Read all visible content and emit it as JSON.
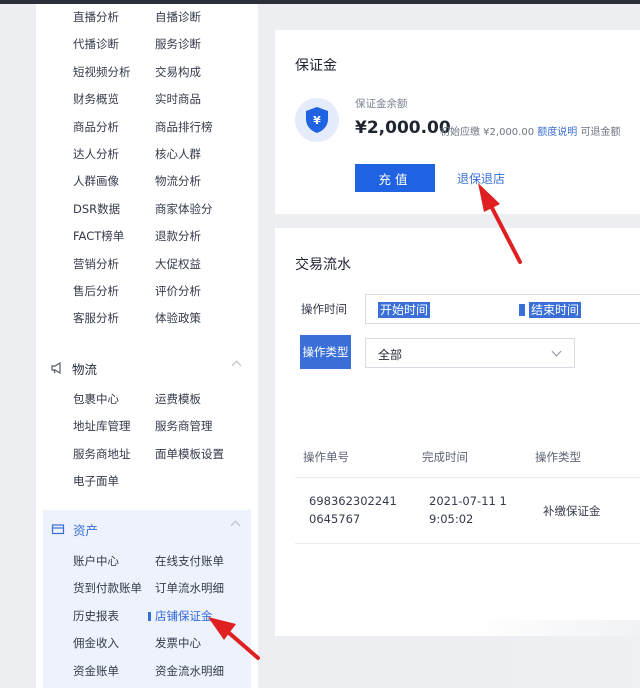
{
  "sidebar": {
    "top_items": [
      [
        "直播分析",
        "自播诊断"
      ],
      [
        "代播诊断",
        "服务诊断"
      ],
      [
        "短视频分析",
        "交易构成"
      ],
      [
        "财务概览",
        "实时商品"
      ],
      [
        "商品分析",
        "商品排行榜"
      ],
      [
        "达人分析",
        "核心人群"
      ],
      [
        "人群画像",
        "物流分析"
      ],
      [
        "DSR数据",
        "商家体验分"
      ],
      [
        "FACT榜单",
        "退款分析"
      ],
      [
        "营销分析",
        "大促权益"
      ],
      [
        "售后分析",
        "评价分析"
      ],
      [
        "客服分析",
        "体验政策"
      ]
    ],
    "logistics": {
      "title": "物流",
      "items": [
        [
          "包裹中心",
          "运费模板"
        ],
        [
          "地址库管理",
          "服务商管理"
        ],
        [
          "服务商地址",
          "面单模板设置"
        ],
        [
          "电子面单",
          ""
        ]
      ]
    },
    "assets": {
      "title": "资产",
      "items": [
        [
          "账户中心",
          "在线支付账单"
        ],
        [
          "货到付款账单",
          "订单流水明细"
        ],
        [
          "历史报表",
          "店铺保证金"
        ],
        [
          "佣金收入",
          "发票中心"
        ],
        [
          "资金账单",
          "资金流水明细"
        ]
      ]
    }
  },
  "deposit": {
    "title": "保证金",
    "balance_label": "保证金余额",
    "balance_amount": "¥2,000.00",
    "initial_due": "初始应缴 ¥2,000.00",
    "limit_link": "额度说明",
    "refundable": "可退金额",
    "recharge_button": "充值",
    "refund_link": "退保退店"
  },
  "transactions": {
    "title": "交易流水",
    "op_time_label": "操作时间",
    "start_placeholder": "开始时间",
    "end_placeholder": "结束时间",
    "op_type_label": "操作类型",
    "op_type_value": "全部",
    "table": {
      "headers": [
        "操作单号",
        "完成时间",
        "操作类型"
      ],
      "rows": [
        {
          "id": "6983623022410645767",
          "time": "2021-07-11 19:05:02",
          "type": "补缴保证金"
        }
      ]
    }
  },
  "colors": {
    "accent": "#1f63e3",
    "link": "#3a6fd8",
    "annotation_arrow": "#e02020"
  }
}
